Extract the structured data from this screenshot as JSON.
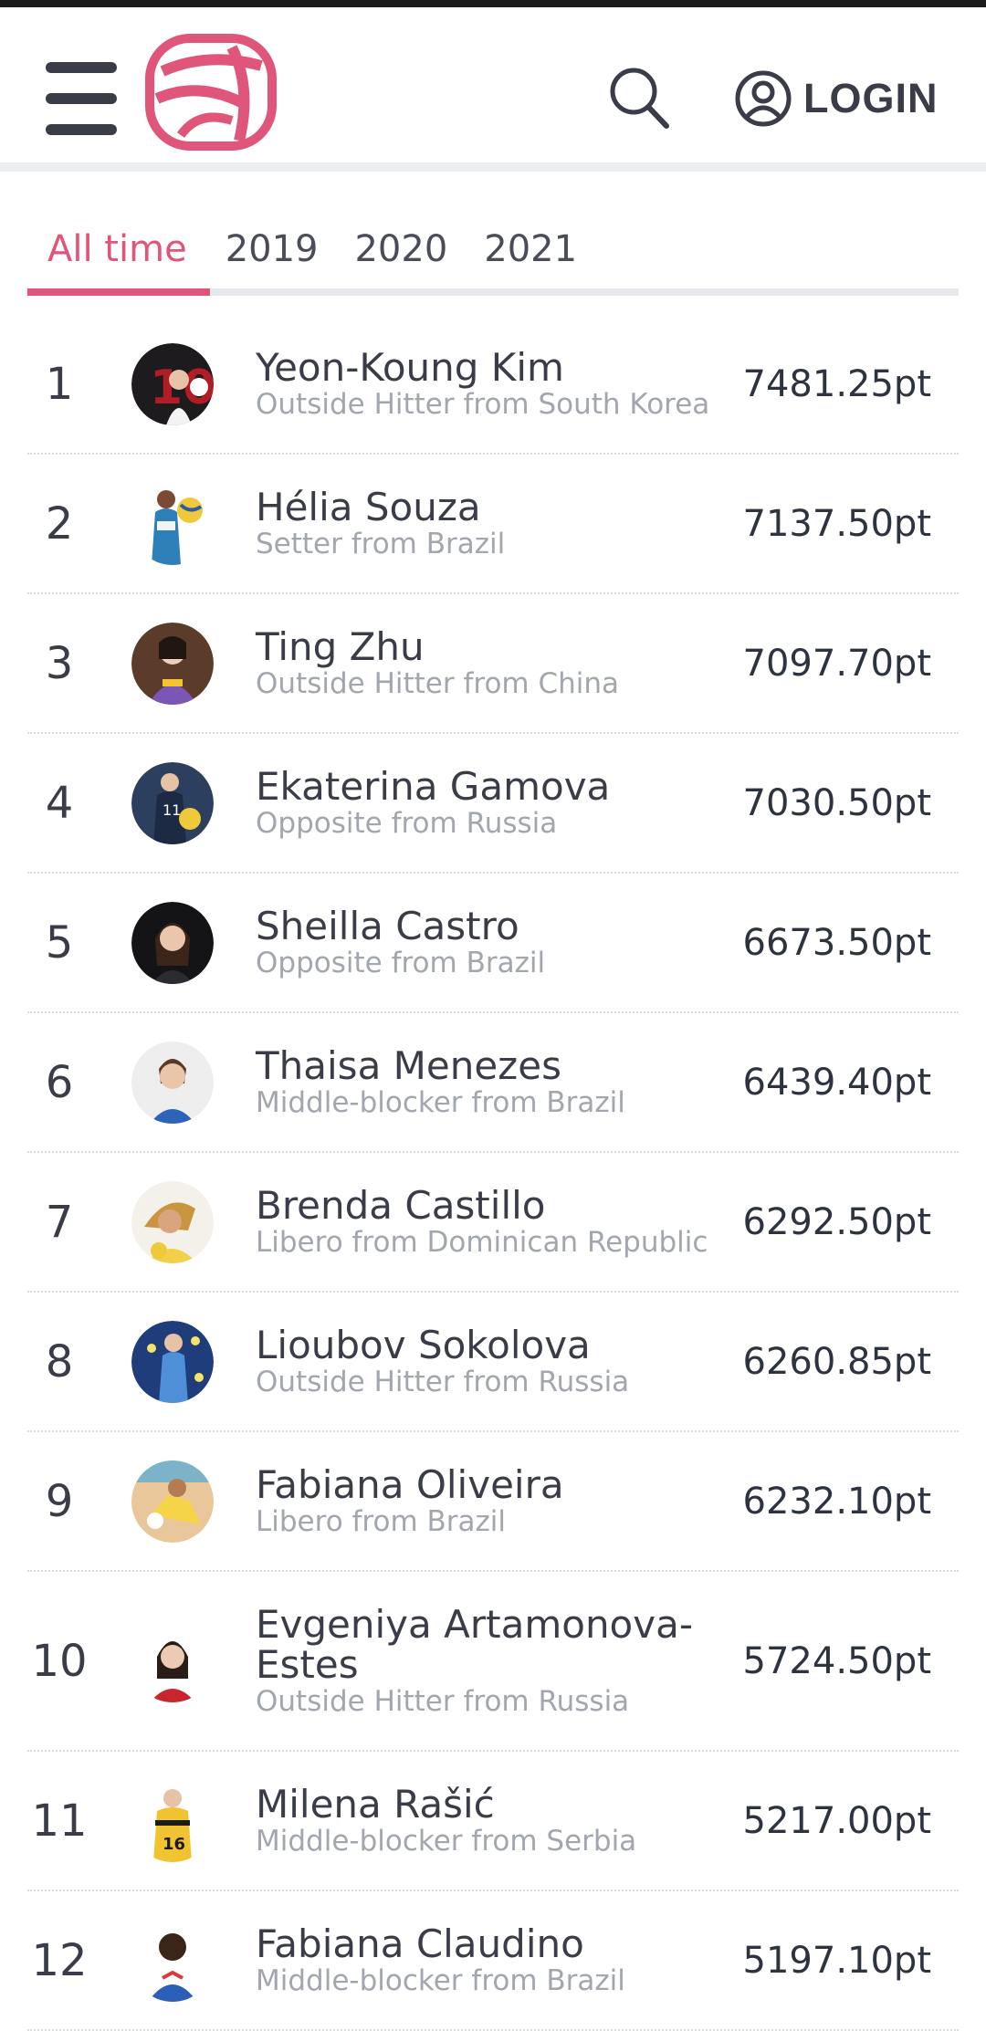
{
  "header": {
    "menu_icon": "hamburger-menu-icon",
    "logo_icon": "volleyball-logo-icon",
    "search_icon": "search-icon",
    "user_icon": "user-circle-icon",
    "login_label": "LOGIN",
    "accent_color": "#e0557a"
  },
  "tabs": [
    {
      "label": "All time",
      "active": true
    },
    {
      "label": "2019",
      "active": false
    },
    {
      "label": "2020",
      "active": false
    },
    {
      "label": "2021",
      "active": false
    }
  ],
  "rankings": [
    {
      "rank": "1",
      "name": "Yeon-Koung Kim",
      "subtitle": "Outside Hitter from South Korea",
      "points": "7481.25pt"
    },
    {
      "rank": "2",
      "name": "Hélia Souza",
      "subtitle": "Setter from Brazil",
      "points": "7137.50pt"
    },
    {
      "rank": "3",
      "name": "Ting Zhu",
      "subtitle": "Outside Hitter from China",
      "points": "7097.70pt"
    },
    {
      "rank": "4",
      "name": "Ekaterina Gamova",
      "subtitle": "Opposite from Russia",
      "points": "7030.50pt"
    },
    {
      "rank": "5",
      "name": "Sheilla Castro",
      "subtitle": "Opposite from Brazil",
      "points": "6673.50pt"
    },
    {
      "rank": "6",
      "name": "Thaisa Menezes",
      "subtitle": "Middle-blocker from Brazil",
      "points": "6439.40pt"
    },
    {
      "rank": "7",
      "name": "Brenda Castillo",
      "subtitle": "Libero from Dominican Republic",
      "points": "6292.50pt"
    },
    {
      "rank": "8",
      "name": "Lioubov Sokolova",
      "subtitle": "Outside Hitter from Russia",
      "points": "6260.85pt"
    },
    {
      "rank": "9",
      "name": "Fabiana Oliveira",
      "subtitle": "Libero from Brazil",
      "points": "6232.10pt"
    },
    {
      "rank": "10",
      "name": "Evgeniya Artamonova-Estes",
      "subtitle": "Outside Hitter from Russia",
      "points": "5724.50pt"
    },
    {
      "rank": "11",
      "name": "Milena Rašić",
      "subtitle": "Middle-blocker from Serbia",
      "points": "5217.00pt"
    },
    {
      "rank": "12",
      "name": "Fabiana Claudino",
      "subtitle": "Middle-blocker from Brazil",
      "points": "5197.10pt"
    }
  ]
}
